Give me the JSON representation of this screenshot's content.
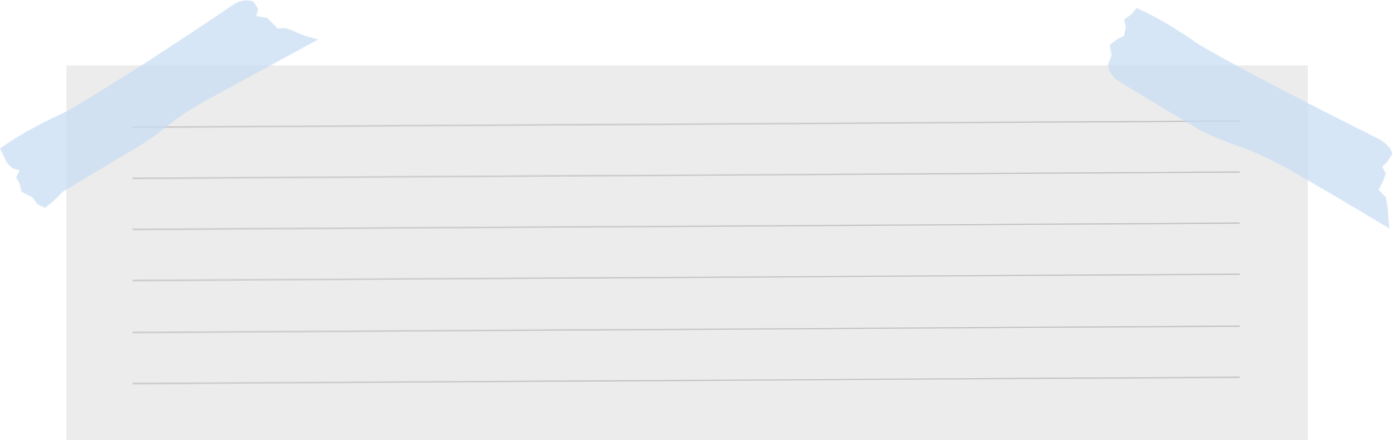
{
  "note_card": {
    "paper_color": "#ececec",
    "rule_color": "#c4c4c4",
    "rule_count": 6,
    "text_lines": [
      "",
      "",
      "",
      "",
      "",
      ""
    ]
  },
  "tape": {
    "color": "#d6e6f5",
    "pieces": [
      {
        "name": "tape-top-left"
      },
      {
        "name": "tape-top-right"
      }
    ]
  }
}
